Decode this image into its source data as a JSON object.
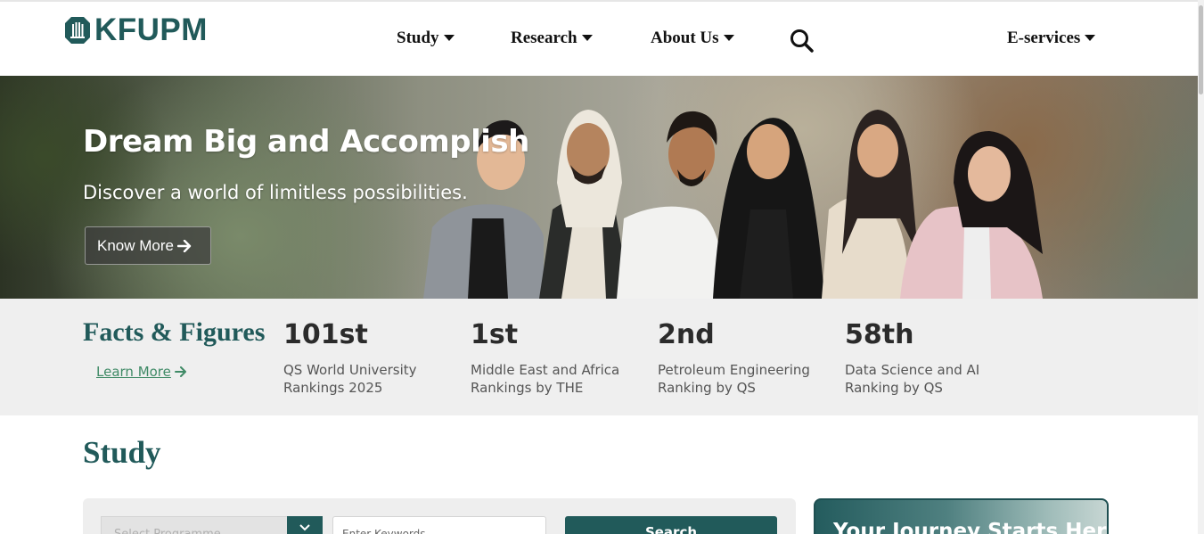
{
  "header": {
    "logo_text": "KFUPM",
    "nav": [
      {
        "label": "Study"
      },
      {
        "label": "Research"
      },
      {
        "label": "About Us"
      }
    ],
    "eservices_label": "E-services"
  },
  "hero": {
    "title": "Dream Big and Accomplish",
    "subtitle": "Discover a world of limitless possibilities.",
    "button_label": "Know More"
  },
  "facts": {
    "title": "Facts & Figures",
    "learn_more": "Learn More",
    "stats": [
      {
        "value": "101st",
        "desc": "QS World University Rankings 2025"
      },
      {
        "value": "1st",
        "desc": "Middle East and Africa Rankings by THE"
      },
      {
        "value": "2nd",
        "desc": "Petroleum Engineering Ranking by QS"
      },
      {
        "value": "58th",
        "desc": "Data Science and AI Ranking by QS"
      }
    ]
  },
  "study": {
    "title": "Study",
    "program_placeholder": "Select Programme",
    "keyword_placeholder": "Enter Keywords",
    "search_label": "Search",
    "journey_title": "Your Journey Starts Here"
  },
  "colors": {
    "brand": "#215a5a",
    "link": "#3f8a66",
    "facts_bg": "#efefef"
  },
  "icons": [
    "university-logo-icon",
    "caret-down-icon",
    "search-icon",
    "arrow-right-icon"
  ]
}
